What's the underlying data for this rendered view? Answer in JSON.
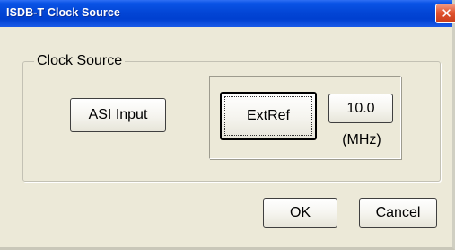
{
  "window": {
    "title": "ISDB-T Clock Source",
    "close_glyph": "✕"
  },
  "group": {
    "label": "Clock Source"
  },
  "buttons": {
    "asi_input": "ASI Input",
    "ext_ref": "ExtRef",
    "frequency_value": "10.0",
    "ok": "OK",
    "cancel": "Cancel"
  },
  "frequency_unit": "(MHz)",
  "colors": {
    "titlebar_blue": "#0346d6",
    "dialog_background": "#ece9d8",
    "close_button_red": "#e1542f"
  },
  "selected_source": "ExtRef"
}
